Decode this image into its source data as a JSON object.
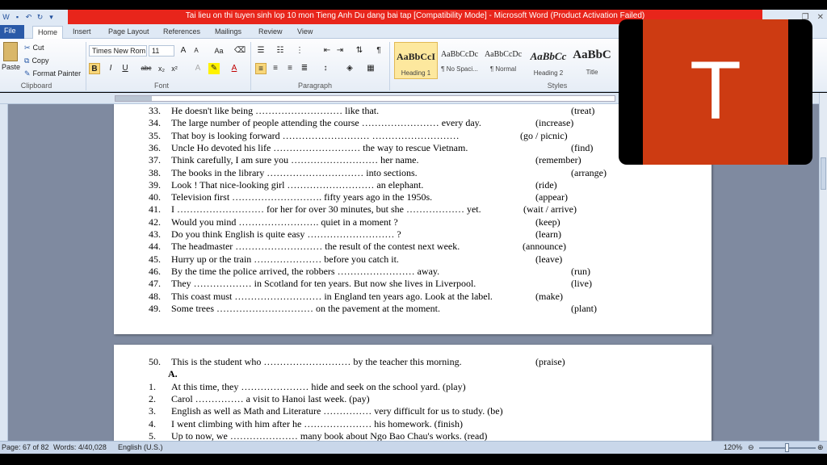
{
  "window": {
    "title": "Tai lieu on thi tuyen sinh lop 10 mon Tieng Anh Du dang bai tap [Compatibility Mode]  -  Microsoft Word (Product Activation Failed)"
  },
  "tabs": [
    "File",
    "Home",
    "Insert",
    "Page Layout",
    "References",
    "Mailings",
    "Review",
    "View"
  ],
  "active_tab": "Home",
  "ribbon": {
    "clipboard": {
      "paste_label": "Paste",
      "cut_label": "Cut",
      "copy_label": "Copy",
      "format_painter_label": "Format Painter",
      "group_label": "Clipboard"
    },
    "font": {
      "font_name": "Times New Rom",
      "font_size": "11",
      "grow": "A",
      "shrink": "A",
      "change_case": "Aa",
      "bold": "B",
      "italic": "I",
      "underline": "U",
      "strike": "abc",
      "subscript": "x₂",
      "superscript": "x²",
      "font_color": "A",
      "group_label": "Font"
    },
    "paragraph": {
      "group_label": "Paragraph"
    },
    "styles": {
      "group_label": "Styles",
      "items": [
        {
          "preview": "AaBbCcI",
          "name": "Heading 1"
        },
        {
          "preview": "AaBbCcDc",
          "name": "¶ No Spaci..."
        },
        {
          "preview": "AaBbCcDc",
          "name": "¶ Normal"
        },
        {
          "preview": "AaBbCc",
          "name": "Heading 2"
        },
        {
          "preview": "AaBbC",
          "name": "Title"
        }
      ]
    }
  },
  "document": {
    "page1_lines": [
      {
        "num": "33.",
        "text": "He doesn't like being ……………………… like that.",
        "hint": "(treat)"
      },
      {
        "num": "34.",
        "text": "The large number of people attending the course …………………… every day.",
        "hint": "(increase)"
      },
      {
        "num": "35.",
        "text": "That boy is looking forward ………………………  ………………………",
        "hint": "(go / picnic)"
      },
      {
        "num": "36.",
        "text": "Uncle Ho devoted his life ……………………… the way to rescue Vietnam.",
        "hint": "(find)"
      },
      {
        "num": "37.",
        "text": "Think carefully, I am sure you ……………………… her name.",
        "hint": "(remember)"
      },
      {
        "num": "38.",
        "text": "The books in the library ………………………… into sections.",
        "hint": "(arrange)"
      },
      {
        "num": "39.",
        "text": "Look !  That nice-looking girl ……………………… an elephant.",
        "hint": "(ride)"
      },
      {
        "num": "40.",
        "text": "Television first ………………………. fifty years ago in the 1950s.",
        "hint": "(appear)"
      },
      {
        "num": "41.",
        "text": "I ……………………… for her for over 30 minutes, but she ……………… yet.",
        "hint": "(wait / arrive)"
      },
      {
        "num": "42.",
        "text": "Would you mind ……………………. quiet in a moment ?",
        "hint": "(keep)"
      },
      {
        "num": "43.",
        "text": "Do you think English is quite easy ……………………… ?",
        "hint": "(learn)"
      },
      {
        "num": "44.",
        "text": "The headmaster ……………………… the result of the contest next week.",
        "hint": "(announce)"
      },
      {
        "num": "45.",
        "text": "Hurry up or the train ………………… before you catch it.",
        "hint": "(leave)"
      },
      {
        "num": "46.",
        "text": "By the time the police arrived, the robbers …………………… away.",
        "hint": "(run)"
      },
      {
        "num": "47.",
        "text": "They ……………… in Scotland for ten years. But now she lives in Liverpool.",
        "hint": "(live)"
      },
      {
        "num": "48.",
        "text": "This coast must ……………………… in England ten years ago. Look at the label.",
        "hint": "(make)"
      },
      {
        "num": "49.",
        "text": "Some trees ………………………… on the pavement at the moment.",
        "hint": "(plant)"
      }
    ],
    "page2_lines": [
      {
        "num": "50.",
        "text": "This is the student who ……………………… by the teacher this morning.",
        "hint": "(praise)"
      },
      {
        "num": "",
        "text": "A.",
        "hint": "",
        "head": true
      },
      {
        "num": "1.",
        "text": "At this time, they ………………… hide and seek on the school yard. (play)",
        "hint": ""
      },
      {
        "num": "2.",
        "text": "Carol …………… a visit to Hanoi last week. (pay)",
        "hint": ""
      },
      {
        "num": "3.",
        "text": "English as well as Math and Literature …………… very difficult for us to study. (be)",
        "hint": ""
      },
      {
        "num": "4.",
        "text": "I went climbing with him after he ………………… his homework. (finish)",
        "hint": ""
      },
      {
        "num": "5.",
        "text": "Up to now, we ………………… many book  about Ngo Bao Chau's works. (read)",
        "hint": ""
      }
    ]
  },
  "status": {
    "page": "Page: 67 of 82",
    "words": "Words: 4/40,028",
    "language": "English (U.S.)",
    "zoom": "120%"
  },
  "overlay": {
    "letter": "T"
  },
  "colors": {
    "title_bar": "#e8251b",
    "file_tab": "#2a5aa8",
    "overlay_tile": "#cd3b12"
  }
}
